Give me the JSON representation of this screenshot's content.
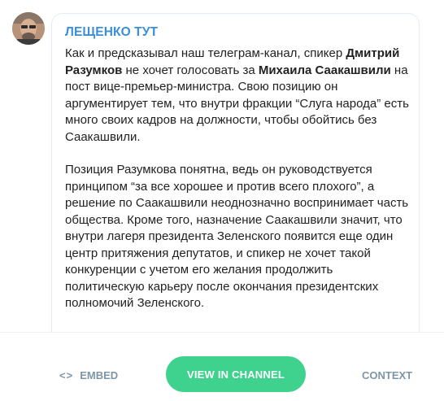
{
  "channel": {
    "name": "ЛЕЩЕНКО ТУТ"
  },
  "message": {
    "p1": {
      "t1": "Как и предсказывал наш телеграм-канал, спикер ",
      "b1": "Дмитрий Разумков",
      "t2": " не хочет голосовать за ",
      "b2": "Михаила Саакашвили",
      "t3": " на пост вице-премьер-министра. Свою позицию он аргументирует тем, что внутри фракции “Слуга народа” есть много своих кадров на должности, чтобы обойтись без Саакашвили."
    },
    "p2": "Позиция Разумкова понятна, ведь он руководствуется принципом “за все хорошее и против всего плохого”, а решение по Саакашвили неоднозначно воспринимает часть общества. Кроме того, назначение Саакашвили значит, что внутри лагеря президента Зеленского появится еще один центр притяжения депутатов, и спикер не хочет такой конкуренции с учетом его желания продолжить политическую карьеру после окончания президентских полномочий Зеленского."
  },
  "footer": {
    "embed_icon": "<>",
    "embed_label": "EMBED",
    "view_label": "VIEW IN CHANNEL",
    "context_label": "CONTEXT"
  },
  "colors": {
    "accent": "#3a8fd6",
    "button": "#3ed28e",
    "muted": "#7f96aa"
  },
  "icons": {
    "avatar": "avatar-photo",
    "embed": "code-icon"
  }
}
